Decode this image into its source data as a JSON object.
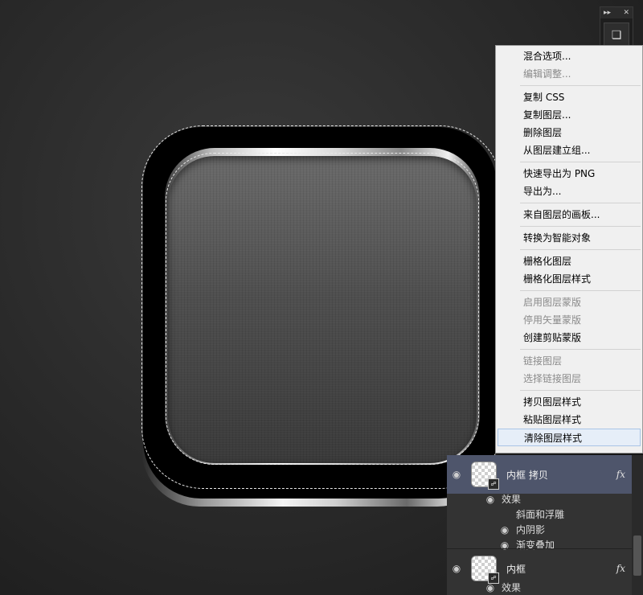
{
  "context_menu": {
    "items": [
      {
        "label": "混合选项...",
        "disabled": false
      },
      {
        "label": "编辑调整...",
        "disabled": true
      },
      {
        "label": "复制 CSS",
        "disabled": false
      },
      {
        "label": "复制图层...",
        "disabled": false
      },
      {
        "label": "删除图层",
        "disabled": false
      },
      {
        "label": "从图层建立组...",
        "disabled": false
      },
      {
        "label": "快速导出为 PNG",
        "disabled": false
      },
      {
        "label": "导出为...",
        "disabled": false
      },
      {
        "label": "来自图层的画板...",
        "disabled": false
      },
      {
        "label": "转换为智能对象",
        "disabled": false
      },
      {
        "label": "栅格化图层",
        "disabled": false
      },
      {
        "label": "栅格化图层样式",
        "disabled": false
      },
      {
        "label": "启用图层蒙版",
        "disabled": true
      },
      {
        "label": "停用矢量蒙版",
        "disabled": true
      },
      {
        "label": "创建剪贴蒙版",
        "disabled": false
      },
      {
        "label": "链接图层",
        "disabled": true
      },
      {
        "label": "选择链接图层",
        "disabled": true
      },
      {
        "label": "拷贝图层样式",
        "disabled": false
      },
      {
        "label": "粘贴图层样式",
        "disabled": false
      },
      {
        "label": "清除图层样式",
        "disabled": false,
        "hovered": true
      }
    ]
  },
  "layers_panel": {
    "layers": [
      {
        "name": "内框 拷贝",
        "fx": "fx",
        "selected": true,
        "effects_label": "效果",
        "effects": [
          "斜面和浮雕",
          "内阴影",
          "渐变叠加"
        ]
      },
      {
        "name": "内框",
        "fx": "fx",
        "selected": false,
        "effects_label": "效果"
      }
    ]
  },
  "mini_panel": {
    "expand_icon": "double-chevron-icon",
    "close_icon": "close-icon",
    "tool_icon": "cube-icon"
  },
  "colors": {
    "menu_bg": "#f0f0f0",
    "menu_hover": "#e6eef8",
    "layer_selected": "#4e556b",
    "panel_bg": "#333333"
  }
}
